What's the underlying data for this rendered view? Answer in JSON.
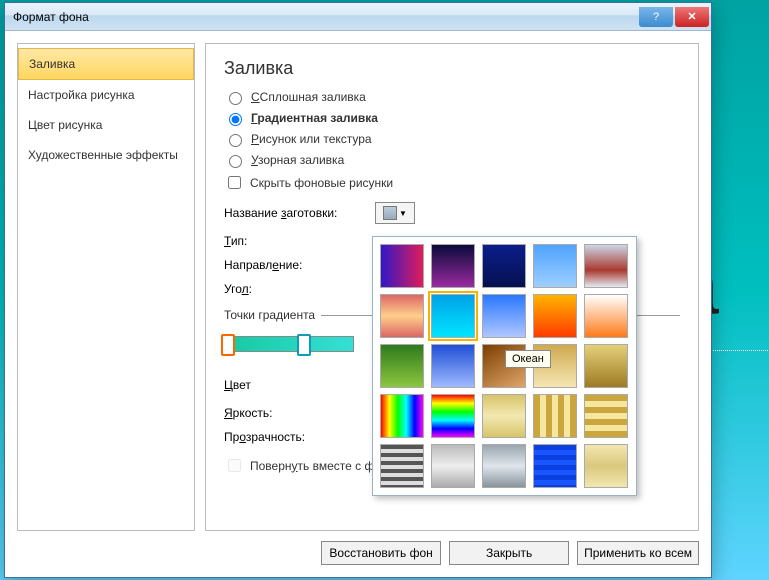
{
  "titlebar": {
    "title": "Формат фона"
  },
  "sidebar": {
    "items": [
      {
        "label": "Заливка",
        "selected": true
      },
      {
        "label": "Настройка рисунка",
        "selected": false
      },
      {
        "label": "Цвет рисунка",
        "selected": false
      },
      {
        "label": "Художественные эффекты",
        "selected": false
      }
    ]
  },
  "content": {
    "heading": "Заливка",
    "radios": [
      {
        "label": "Сплошная заливка",
        "prefix": "С",
        "checked": false
      },
      {
        "label": "радиентная заливка",
        "prefix": "Г",
        "checked": true,
        "bold": true
      },
      {
        "label": "исунок или текстура",
        "prefix": "Р",
        "checked": false
      },
      {
        "label": "зорная заливка",
        "prefix": "У",
        "checked": false
      }
    ],
    "hide_bg": {
      "label": "Скрыть фоновые рисунки",
      "checked": false,
      "prefix": ""
    },
    "preset_label_pre": "Название ",
    "preset_label_u": "з",
    "preset_label_post": "аготовки:",
    "type_label_pre": "",
    "type_label_u": "Т",
    "type_label_post": "ип:",
    "direction_label_pre": "Направл",
    "direction_label_u": "е",
    "direction_label_post": "ние:",
    "angle_label_pre": "Уго",
    "angle_label_u": "л",
    "angle_label_post": ":",
    "stops_legend": "Точки градиента",
    "color_label_pre": "",
    "color_label_u": "Ц",
    "color_label_post": "вет",
    "brightness_label_pre": "",
    "brightness_label_u": "Я",
    "brightness_label_post": "ркость:",
    "transparency_label_pre": "Пр",
    "transparency_label_u": "о",
    "transparency_label_post": "зрачность:",
    "rotate_label_pre": "Поверн",
    "rotate_label_u": "у",
    "rotate_label_post": "ть вместе с фигурой"
  },
  "presets": {
    "tooltip": "Океан",
    "items": [
      {
        "name": "p1",
        "bg": "linear-gradient(to right,#3018c8,#e01b5a)"
      },
      {
        "name": "p2",
        "bg": "linear-gradient(to bottom,#0a0a3a,#9a2aa0)"
      },
      {
        "name": "p3",
        "bg": "linear-gradient(to bottom,#0b1e8c,#061050)"
      },
      {
        "name": "p4",
        "bg": "linear-gradient(to bottom,#4fa3ff,#9ecfff)"
      },
      {
        "name": "p5",
        "bg": "linear-gradient(to bottom,#cbd5e6,#aa3a2e 60%,#e5eaf2)"
      },
      {
        "name": "p6",
        "bg": "linear-gradient(to bottom,#d66,#ffcf8a 50%,#d66)"
      },
      {
        "name": "p7",
        "bg": "linear-gradient(to bottom,#00a2e8,#00e5ff)",
        "selected": true
      },
      {
        "name": "p8",
        "bg": "linear-gradient(to bottom,#2a77ff,#b0c7ff)"
      },
      {
        "name": "p9",
        "bg": "linear-gradient(to bottom,#ffb300,#ff3b00)"
      },
      {
        "name": "p10",
        "bg": "linear-gradient(to bottom,#fff,#ff7a1a)"
      },
      {
        "name": "p11",
        "bg": "linear-gradient(to bottom,#2f7a1d,#8dc63f)"
      },
      {
        "name": "p12",
        "bg": "linear-gradient(to bottom,#1f4fd6,#9fbaff)"
      },
      {
        "name": "p13",
        "bg": "linear-gradient(150deg,#7b3f00,#e0a56a)"
      },
      {
        "name": "p14",
        "bg": "linear-gradient(to bottom,#cfa94e,#f6e6b4)"
      },
      {
        "name": "p15",
        "bg": "linear-gradient(to bottom,#e6cf7a,#9c7b23)"
      },
      {
        "name": "p16",
        "bg": "linear-gradient(to right,#ff0000,#ffff00,#00ff00,#00ffff,#0000ff,#ff00ff)"
      },
      {
        "name": "p17",
        "bg": "linear-gradient(to bottom,#ff0000,#ffff00,#00ff00,#00ffff,#0000ff,#ff00ff)"
      },
      {
        "name": "p18",
        "bg": "linear-gradient(to bottom,#d8c46a,#f2e9b2 50%,#d8c46a)"
      },
      {
        "name": "p19",
        "bg": "repeating-linear-gradient(to right,#caa63d 0 6px,#f5e6a0 6px 12px)"
      },
      {
        "name": "p20",
        "bg": "repeating-linear-gradient(to bottom,#caa63d 0 6px,#f5e6a0 6px 12px)"
      },
      {
        "name": "p21",
        "bg": "repeating-linear-gradient(to bottom,#555 0 4px,#ddd 4px 8px)"
      },
      {
        "name": "p22",
        "bg": "linear-gradient(to bottom,#bbb,#eee 50%,#aaa)"
      },
      {
        "name": "p23",
        "bg": "linear-gradient(to bottom,#9aa5b0,#dfe6ec 50%,#8a939c)"
      },
      {
        "name": "p24",
        "bg": "repeating-linear-gradient(to bottom,#0b3fe0 0 5px,#1a56ff 5px 10px)"
      },
      {
        "name": "p25",
        "bg": "linear-gradient(to bottom,#f3e6b0,#d9c97d 50%,#f3e6b0)"
      }
    ]
  },
  "footer": {
    "reset": "Восстановить фон",
    "close": "Закрыть",
    "apply_all": "Применить ко всем"
  },
  "bg_letter": "а"
}
